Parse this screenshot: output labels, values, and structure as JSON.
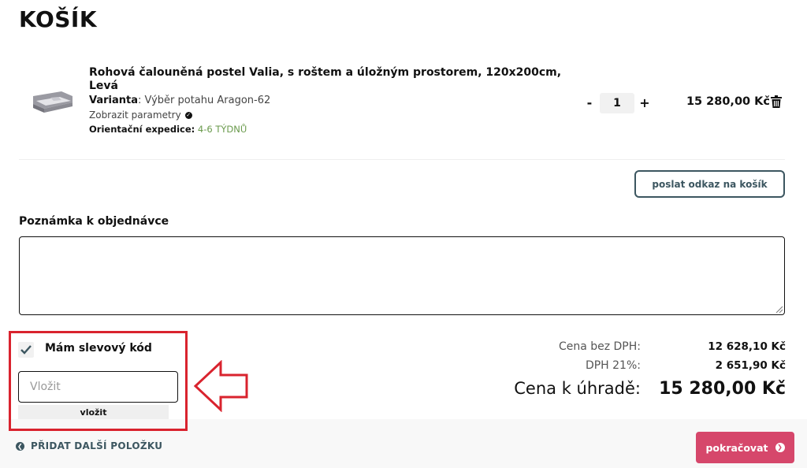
{
  "page": {
    "title": "KOŠÍK"
  },
  "cart": {
    "item": {
      "name": "Rohová čalouněná postel Valia, s roštem a úložným prostorem, 120x200cm, Levá",
      "variant_label": "Varianta",
      "variant_value": ": Výběr potahu Aragon-62",
      "params_link": "Zobrazit parametry",
      "expedice_label": "Orientační expedice:",
      "expedice_value": "4-6 TÝDNŮ",
      "quantity": "1",
      "minus": "-",
      "plus": "+",
      "price": "15 280,00 Kč"
    },
    "share_button": "poslat odkaz na košík"
  },
  "note": {
    "label": "Poznámka k objednávce",
    "placeholder": ""
  },
  "discount": {
    "checkbox_label": "Mám slevový kód",
    "checked": true,
    "input_placeholder": "Vložit",
    "apply_button": "vložit"
  },
  "totals": {
    "without_vat_label": "Cena bez DPH:",
    "without_vat_value": "12 628,10 Kč",
    "vat_label": "DPH 21%:",
    "vat_value": "2 651,90 Kč",
    "total_label": "Cena k úhradě:",
    "total_value": "15 280,00 Kč"
  },
  "footer": {
    "add_more": "PŘIDAT DALŠÍ POLOŽKU",
    "continue": "pokračovat"
  },
  "colors": {
    "accent_dark": "#3c5660",
    "accent_pink": "#d6476b",
    "highlight_red": "#d9232e",
    "delivery_green": "#6a9a4c"
  },
  "icons": {
    "product_thumb": "bed-thumbnail",
    "delete": "trash-icon",
    "params": "check-circle-icon",
    "checkbox": "checkmark-icon",
    "annotation": "arrow-left-icon",
    "back": "chevron-left-circle-icon",
    "forward": "chevron-right-circle-icon"
  }
}
